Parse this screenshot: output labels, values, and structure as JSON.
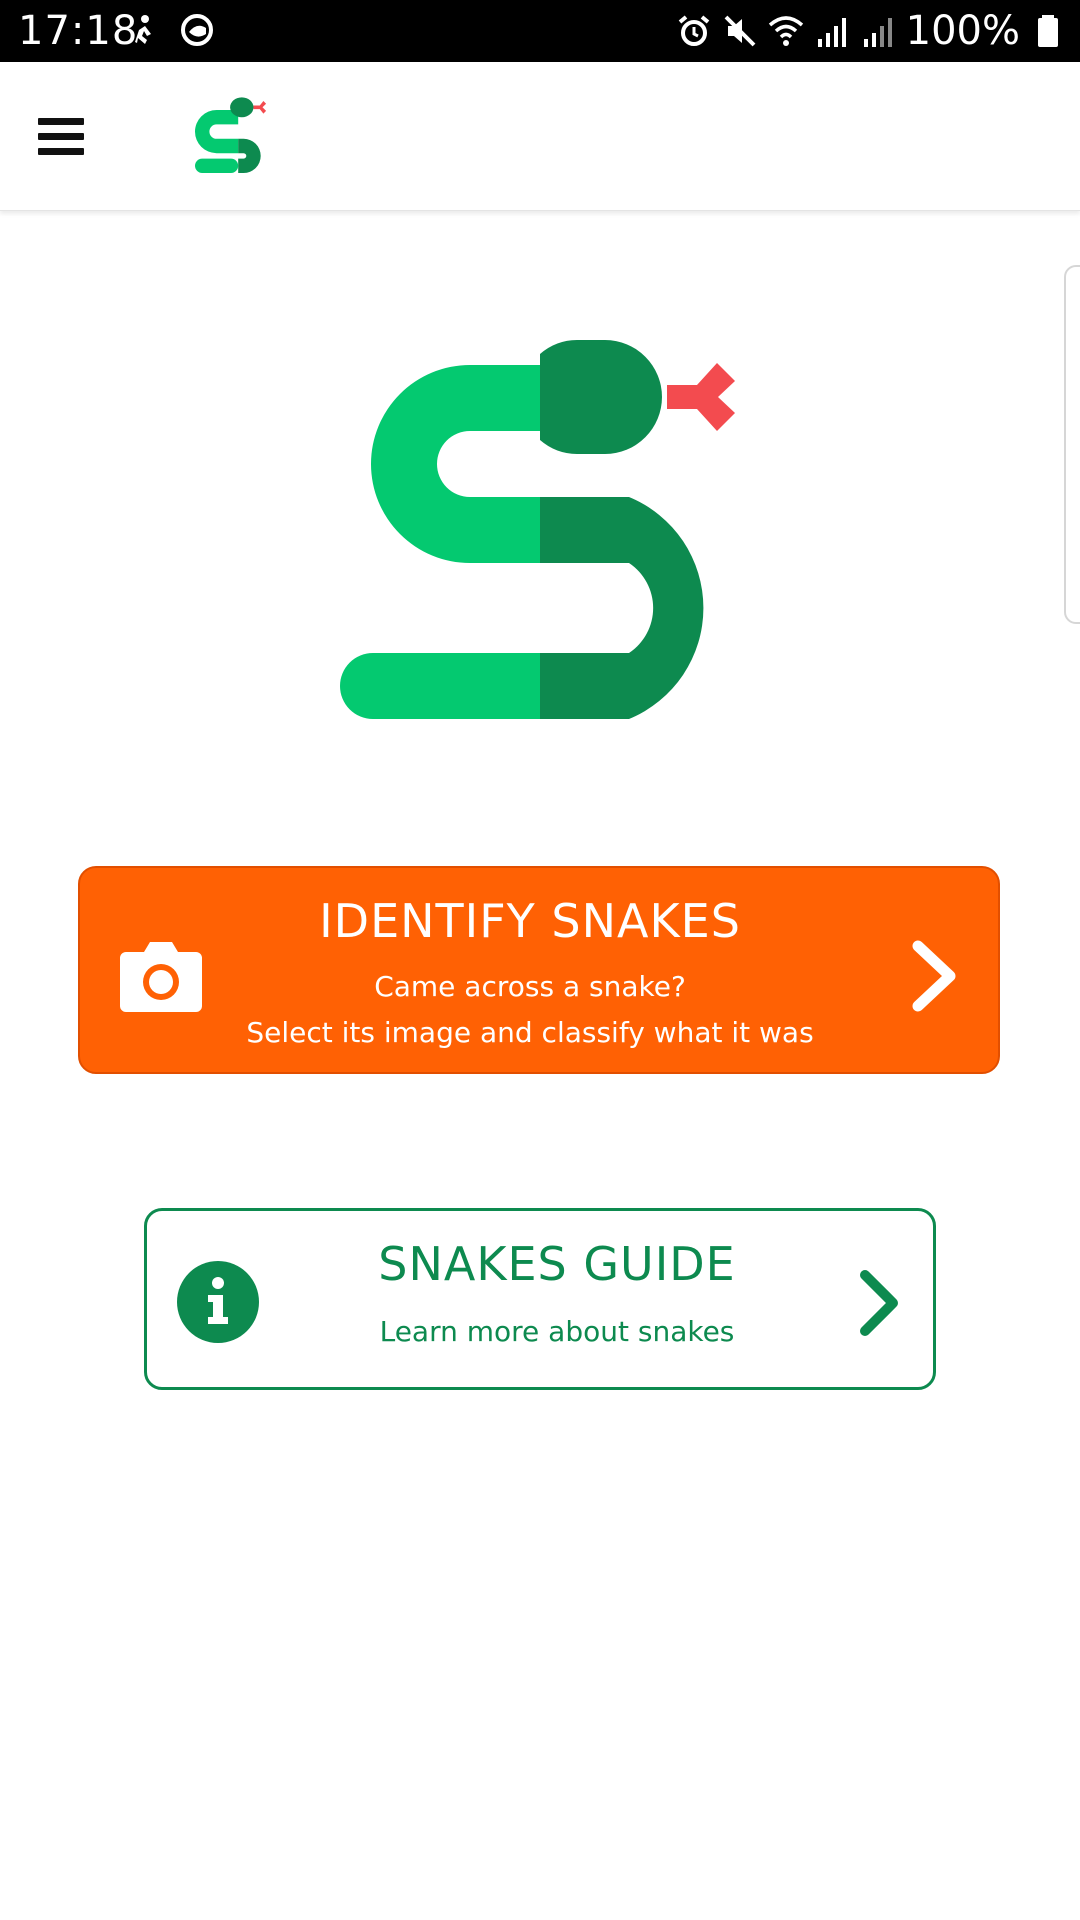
{
  "status_bar": {
    "time": "17:18",
    "battery": "100%",
    "left_icons": [
      "person-walking-icon",
      "face-scan-icon"
    ],
    "right_icons": [
      "alarm-icon",
      "mute-icon",
      "wifi-icon",
      "signal-icon",
      "signal-icon",
      "battery-icon"
    ]
  },
  "app_bar": {
    "menu_icon": "hamburger-menu-icon",
    "logo_icon": "snake-logo-icon"
  },
  "colors": {
    "green_light": "#04c970",
    "green_dark": "#0d8a4f",
    "tongue_red": "#f34b4f",
    "identify_orange": "#ff6104"
  },
  "hero": {
    "logo_icon": "snake-logo-icon"
  },
  "identify_card": {
    "title": "IDENTIFY SNAKES",
    "subtitle_line1": "Came across a snake?",
    "subtitle_line2": "Select its image and classify what it was",
    "icon": "camera-icon",
    "chevron_icon": "chevron-right-icon"
  },
  "guide_card": {
    "title": "SNAKES GUIDE",
    "subtitle": "Learn more about snakes",
    "icon": "info-icon",
    "chevron_icon": "chevron-right-icon"
  }
}
